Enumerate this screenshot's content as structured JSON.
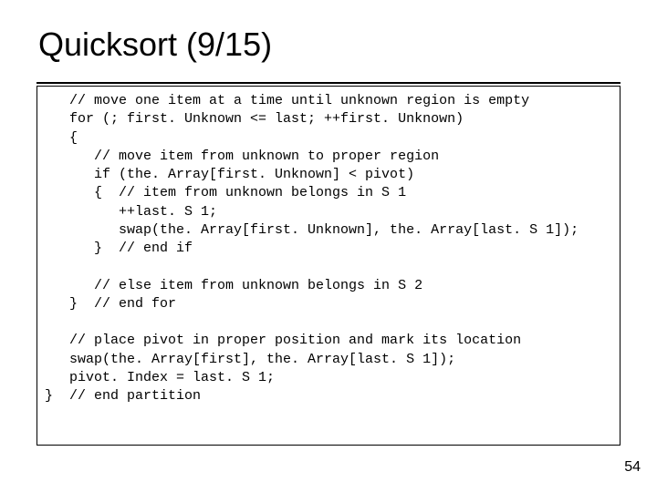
{
  "slide": {
    "title": "Quicksort (9/15)",
    "page_number": "54"
  },
  "code": {
    "l01a": "   // move one item at a time until unknown region is empty",
    "l02a": "   for (; first. Unknown <= last; ++first. Unknown)",
    "l03a": "   {",
    "l04a": "      // move item from unknown to proper region",
    "l05a": "      if (the. Array[first. Unknown] < pivot)",
    "l06a": "      {  // item from unknown belongs in S 1",
    "l07a": "         ++last. S 1;",
    "l08a": "         swap(the. Array[first. Unknown], the. Array[last. S 1]);",
    "l09a": "      }  // end if",
    "l10a": "",
    "l11a": "      // else item from unknown belongs in S 2",
    "l12a": "   }  // end for",
    "l13a": "",
    "l14a": "   // place pivot in proper position and mark its location",
    "l15a": "   swap(the. Array[first], the. Array[last. S 1]);",
    "l16a": "   pivot. Index = last. S 1;",
    "l17a": "}  // end partition"
  }
}
